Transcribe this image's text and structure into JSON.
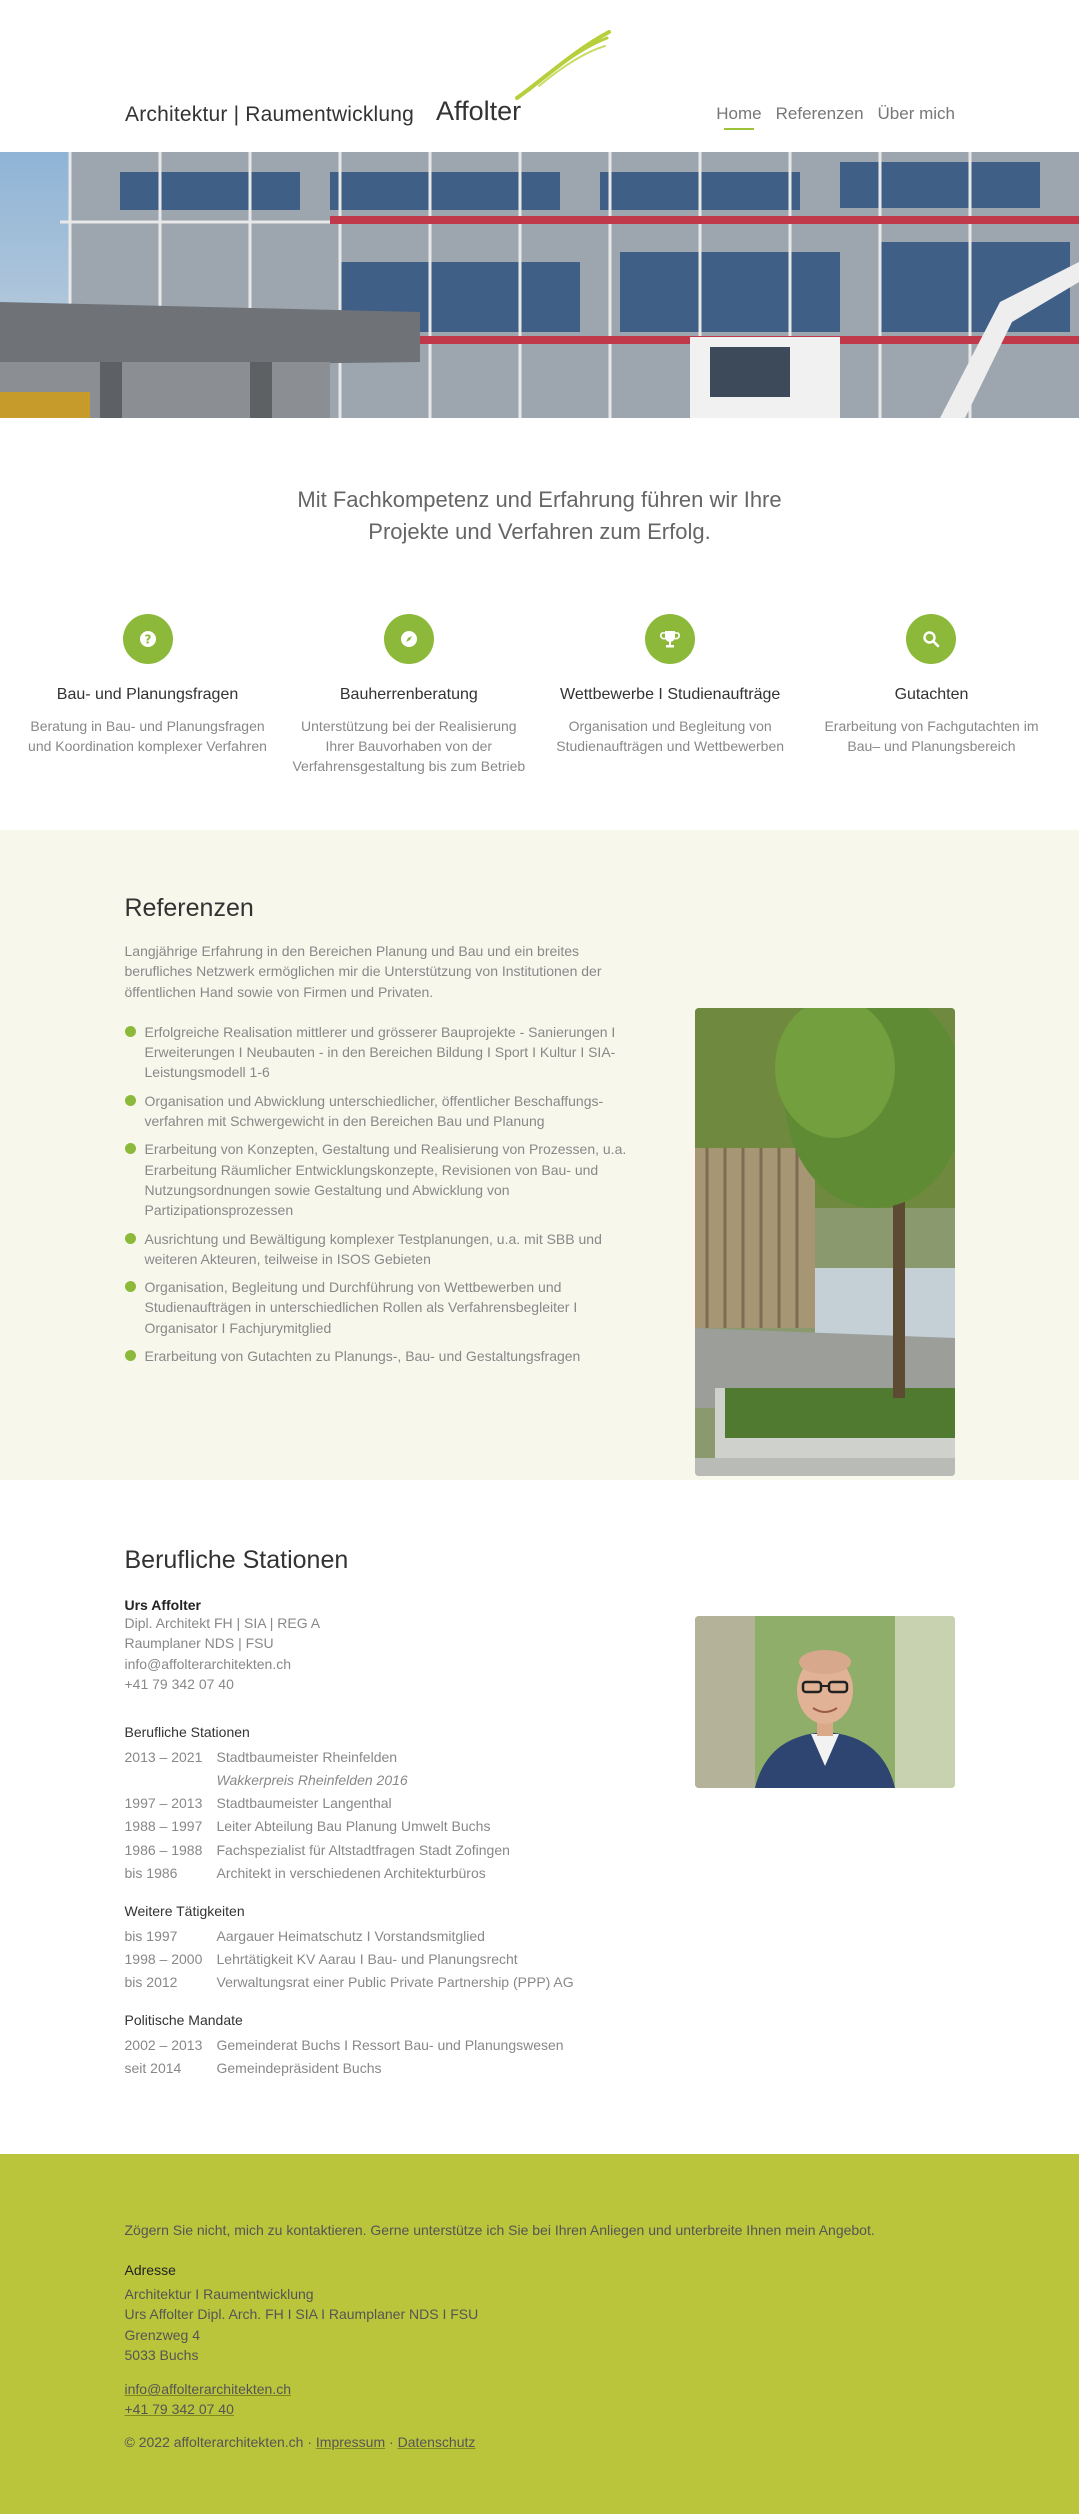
{
  "header": {
    "tagline": "Architektur | Raumentwicklung",
    "brand": "Affolter",
    "nav": [
      {
        "label": "Home",
        "active": true
      },
      {
        "label": "Referenzen",
        "active": false
      },
      {
        "label": "Über mich",
        "active": false
      }
    ]
  },
  "intro": {
    "text": "Mit Fachkompetenz und Erfahrung führen wir Ihre Projekte und Verfahren zum Erfolg."
  },
  "services": [
    {
      "icon": "question-icon",
      "title": "Bau- und Planungsfragen",
      "desc": "Beratung in Bau- und Planungsfragen und Koordination komplexer Verfahren"
    },
    {
      "icon": "compass-icon",
      "title": "Bauherrenberatung",
      "desc": "Unterstützung bei der Realisierung Ihrer Bauvorhaben von der Verfahrensgestaltung bis zum Betrieb"
    },
    {
      "icon": "trophy-icon",
      "title": "Wettbewerbe I Studienaufträge",
      "desc": "Organisation und Begleitung von Studienaufträgen und Wettbewerben"
    },
    {
      "icon": "search-icon",
      "title": "Gutachten",
      "desc": "Erarbeitung von Fachgutachten im Bau– und Planungsbereich"
    }
  ],
  "refs": {
    "heading": "Referenzen",
    "intro": "Langjährige Erfahrung in den Bereichen Planung und Bau und ein breites berufliches Netzwerk ermöglichen mir die Unterstützung von Institutionen der öffentlichen Hand sowie von Firmen und Privaten.",
    "items": [
      "Erfolgreiche Realisation mittlerer und grösserer Bauprojekte - Sanierungen I Erweiterungen I Neubauten - in den Bereichen Bildung I Sport I Kultur I SIA-Leistungsmodell 1-6",
      "Organisation und Abwicklung unterschiedlicher, öffentlicher Beschaffungs-verfahren mit Schwergewicht in den Bereichen Bau und Planung",
      "Erarbeitung von Konzepten, Gestaltung und Realisierung von Prozessen, u.a. Erarbeitung Räumlicher Entwicklungskonzepte, Revisionen von Bau- und Nutzungsordnungen sowie Gestaltung und Abwicklung von Partizipationsprozessen",
      "Ausrichtung und Bewältigung komplexer Testplanungen, u.a. mit SBB und weiteren Akteuren, teilweise in ISOS Gebieten",
      "Organisation, Begleitung und Durchführung von Wettbewerben und Studienaufträgen in unterschiedlichen Rollen als Verfahrensbegleiter I Organisator I Fachjurymitglied",
      "Erarbeitung von Gutachten zu Planungs-, Bau- und Gestaltungsfragen"
    ]
  },
  "stations": {
    "heading": "Berufliche Stationen",
    "person": {
      "name": "Urs Affolter",
      "lines": [
        "Dipl. Architekt FH | SIA | REG A",
        "Raumplaner NDS | FSU",
        "info@affolterarchitekten.ch",
        "+41 79 342 07 40"
      ]
    },
    "career_heading": "Berufliche Stationen",
    "career": [
      {
        "years": "2013 – 2021",
        "text": "Stadtbaumeister Rheinfelden",
        "note": "Wakkerpreis Rheinfelden 2016"
      },
      {
        "years": "1997 – 2013",
        "text": "Stadtbaumeister Langenthal"
      },
      {
        "years": "1988 – 1997",
        "text": "Leiter Abteilung Bau Planung Umwelt Buchs"
      },
      {
        "years": "1986 – 1988",
        "text": "Fachspezialist für Altstadtfragen Stadt Zofingen"
      },
      {
        "years": "bis 1986",
        "text": "Architekt in verschiedenen Architekturbüros"
      }
    ],
    "other_heading": "Weitere Tätigkeiten",
    "other": [
      {
        "years": "bis 1997",
        "text": "Aargauer Heimatschutz I Vorstandsmitglied"
      },
      {
        "years": "1998 – 2000",
        "text": "Lehrtätigkeit KV Aarau I Bau- und Planungsrecht"
      },
      {
        "years": "bis 2012",
        "text": "Verwaltungsrat einer Public Private Partnership (PPP) AG"
      }
    ],
    "political_heading": "Politische Mandate",
    "political": [
      {
        "years": "2002 – 2013",
        "text": "Gemeinderat Buchs I Ressort Bau- und Planungswesen"
      },
      {
        "years": "seit 2014",
        "text": "Gemeindepräsident Buchs"
      }
    ]
  },
  "footer": {
    "cta": "Zögern Sie nicht, mich zu kontaktieren. Gerne unterstütze ich Sie bei Ihren Anliegen und unterbreite Ihnen mein Angebot.",
    "address_heading": "Adresse",
    "address": [
      "Architektur I Raumentwicklung",
      "Urs Affolter Dipl. Arch. FH I SIA I Raumplaner NDS I FSU",
      "Grenzweg 4",
      "5033 Buchs"
    ],
    "email": "info@affolterarchitekten.ch",
    "phone": "+41 79 342 07 40",
    "copyright": "© 2022 affolterarchitekten.ch ·",
    "impressum": "Impressum",
    "sep": "·",
    "datenschutz": "Datenschutz"
  },
  "colors": {
    "accent": "#8cb93a",
    "footer_bg": "#bac53b",
    "refs_bg": "#f8f7ec"
  }
}
